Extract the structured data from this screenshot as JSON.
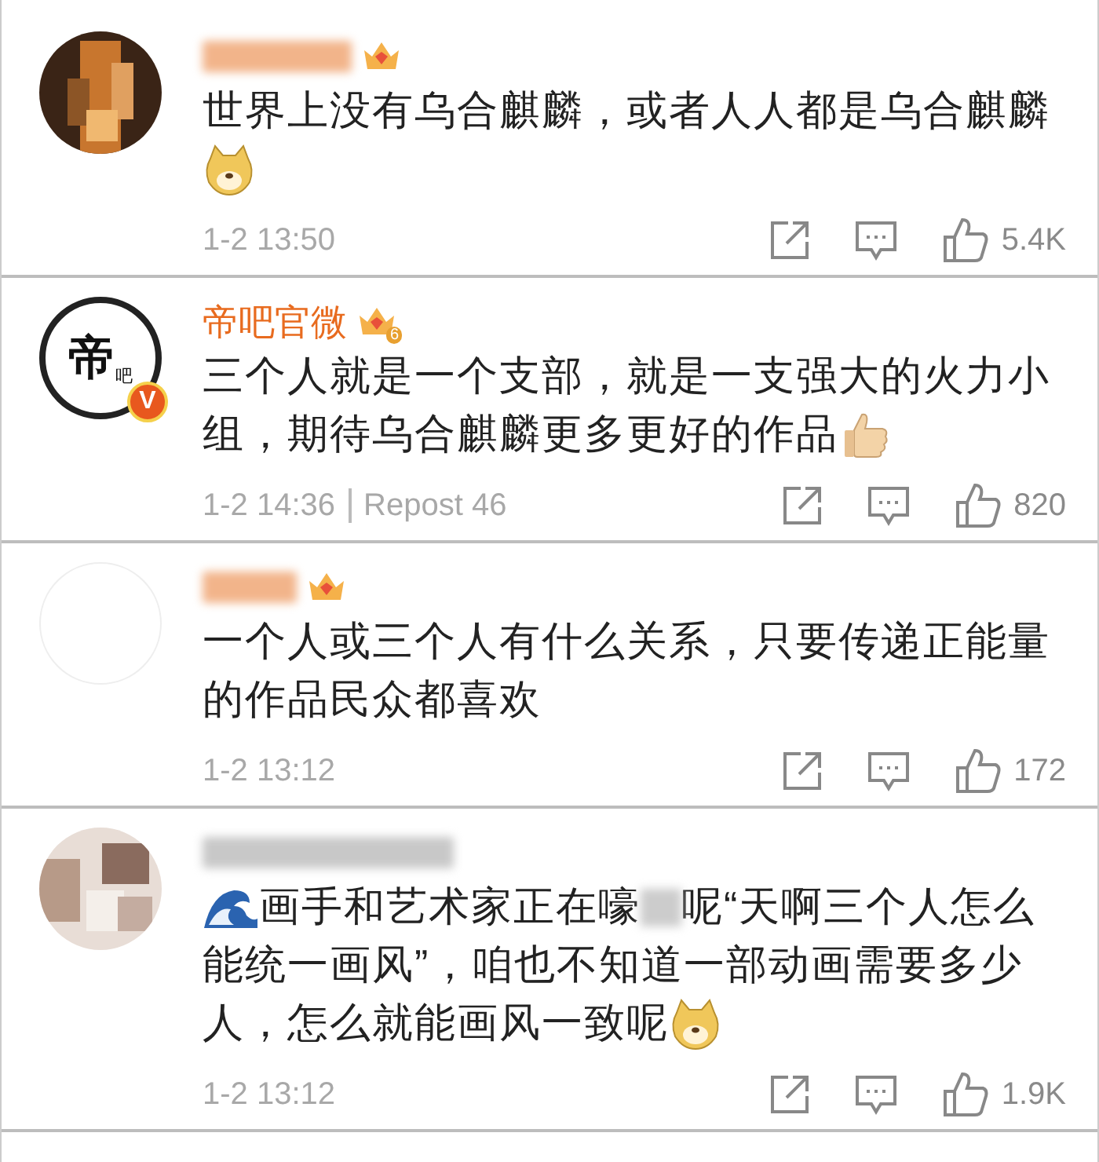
{
  "comments": [
    {
      "avatar": {
        "kind": "picture"
      },
      "name": {
        "kind": "blurred"
      },
      "badge": true,
      "lines": [
        [
          {
            "kind": "text",
            "text": "世界上没有乌合麒麟，或者人人都是乌合麒麟"
          }
        ],
        [
          {
            "kind": "dog"
          }
        ]
      ],
      "time": "1-2 13:50",
      "likes": "5.4K"
    },
    {
      "avatar": {
        "kind": "logo",
        "text": "帝",
        "subtext": "吧",
        "verified": "V"
      },
      "name": {
        "kind": "text",
        "text": "帝吧官微"
      },
      "badge": true,
      "badge_level": "6",
      "lines": [
        [
          {
            "kind": "text",
            "text": "三个人就是一个支部，就是一支强大的火力小"
          }
        ],
        [
          {
            "kind": "text",
            "text": "组，期待乌合麒麟更多更好的作品"
          },
          {
            "kind": "thumb"
          }
        ]
      ],
      "time": "1-2 14:36",
      "repost": "Repost 46",
      "likes": "820"
    },
    {
      "avatar": {
        "kind": "plain"
      },
      "name": {
        "kind": "blurred"
      },
      "badge": true,
      "lines": [
        [
          {
            "kind": "text",
            "text": "一个人或三个人有什么关系，只要传递正能量"
          }
        ],
        [
          {
            "kind": "text",
            "text": "的作品民众都喜欢"
          }
        ]
      ],
      "time": "1-2 13:12",
      "likes": "172"
    },
    {
      "avatar": {
        "kind": "picture"
      },
      "name": {
        "kind": "blurred"
      },
      "badge": false,
      "lines": [
        [
          {
            "kind": "wave"
          },
          {
            "kind": "text",
            "text": "画手和艺术家正在嚎"
          },
          {
            "kind": "blur"
          },
          {
            "kind": "text",
            "text": "呢“天啊三个人怎么"
          }
        ],
        [
          {
            "kind": "text",
            "text": "能统一画风”，咱也不知道一部动画需要多少"
          }
        ],
        [
          {
            "kind": "text",
            "text": "人，怎么就能画风一致呢"
          },
          {
            "kind": "dog"
          }
        ]
      ],
      "time": "1-2 13:12",
      "likes": "1.9K"
    }
  ]
}
